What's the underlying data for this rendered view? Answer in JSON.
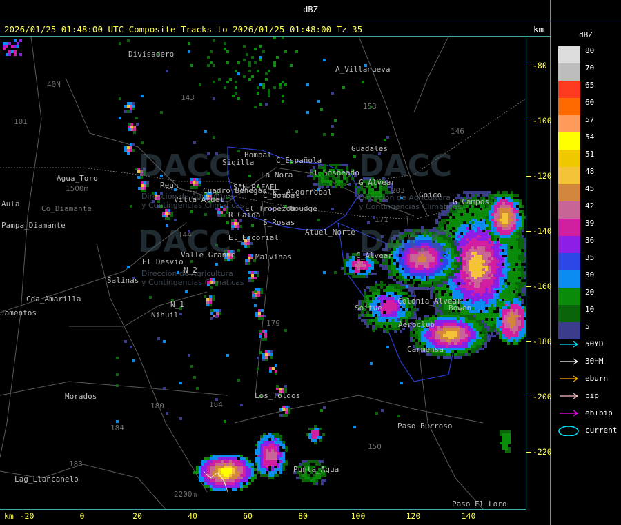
{
  "window": {
    "title": "dBZ"
  },
  "header": {
    "text": "2026/01/25 01:48:00 UTC Composite Tracks to 2026/01/25 01:48:00 Tz 35",
    "km_label": "km"
  },
  "axes": {
    "x_unit": "km",
    "x_ticks": [
      "-20",
      "0",
      "20",
      "40",
      "60",
      "80",
      "100",
      "120",
      "140"
    ],
    "y_ticks": [
      "-80",
      "-100",
      "-120",
      "-140",
      "-160",
      "-180",
      "-200",
      "-220"
    ]
  },
  "legend": {
    "title": "dBZ",
    "items": [
      {
        "label": "80",
        "color": "#dcdcdc"
      },
      {
        "label": "70",
        "color": "#bdbdbd"
      },
      {
        "label": "65",
        "color": "#ff3a1e"
      },
      {
        "label": "60",
        "color": "#ff6a00"
      },
      {
        "label": "57",
        "color": "#ff9a5a"
      },
      {
        "label": "54",
        "color": "#ffff00"
      },
      {
        "label": "51",
        "color": "#f0c800"
      },
      {
        "label": "48",
        "color": "#f5c337"
      },
      {
        "label": "45",
        "color": "#d2873c"
      },
      {
        "label": "42",
        "color": "#c86496"
      },
      {
        "label": "39",
        "color": "#d21ea0"
      },
      {
        "label": "36",
        "color": "#8c1ee6"
      },
      {
        "label": "35",
        "color": "#2d46e6"
      },
      {
        "label": "30",
        "color": "#0a8cf0"
      },
      {
        "label": "20",
        "color": "#0a8c0a"
      },
      {
        "label": "10",
        "color": "#0a640a"
      },
      {
        "label": "5",
        "color": "#3c3c8c"
      }
    ],
    "tracks": [
      {
        "label": "50YD",
        "color": "#00e6ff"
      },
      {
        "label": "30HM",
        "color": "#ffffff"
      },
      {
        "label": "eburn",
        "color": "#ffaa00"
      },
      {
        "label": "bip",
        "color": "#ffc0c0"
      },
      {
        "label": "eb+bip",
        "color": "#ff00ff"
      },
      {
        "label": "current",
        "color": "#00e6ff"
      }
    ]
  },
  "watermark": {
    "brand": "DACC",
    "lines": [
      "Dirección de Agricultura",
      "y Contingencias Climáticas"
    ]
  },
  "places": [
    {
      "name": "Divisadero"
    },
    {
      "name": "A_Villanueva"
    },
    {
      "name": "40N"
    },
    {
      "name": "101"
    },
    {
      "name": "143"
    },
    {
      "name": "153"
    },
    {
      "name": "146"
    },
    {
      "name": "Guadales"
    },
    {
      "name": "Agua_Toro"
    },
    {
      "name": "1500m"
    },
    {
      "name": "Aula"
    },
    {
      "name": "Co_Diamante"
    },
    {
      "name": "Pampa_Diamante"
    },
    {
      "name": "Reun"
    },
    {
      "name": "Villa_Atuel"
    },
    {
      "name": "Cuadro_Benegas"
    },
    {
      "name": "SAN_RAFAEL"
    },
    {
      "name": "Bombal"
    },
    {
      "name": "Sigilla"
    },
    {
      "name": "C_Española"
    },
    {
      "name": "La_Nora"
    },
    {
      "name": "El_Algarrobal"
    },
    {
      "name": "C_Bombal"
    },
    {
      "name": "El_Tropezon"
    },
    {
      "name": "Goudge"
    },
    {
      "name": "R_Caida"
    },
    {
      "name": "S_Rosas"
    },
    {
      "name": "Atuel_Norte"
    },
    {
      "name": "El_Escorial"
    },
    {
      "name": "Valle_Grande"
    },
    {
      "name": "Malvinas"
    },
    {
      "name": "El_Desvio"
    },
    {
      "name": "Salinas"
    },
    {
      "name": "Cda_Amarilla"
    },
    {
      "name": "N_2"
    },
    {
      "name": "N_1"
    },
    {
      "name": "Nihuil"
    },
    {
      "name": "Jamentos"
    },
    {
      "name": "El_Sosneado"
    },
    {
      "name": "G_Alvear"
    },
    {
      "name": "Goico"
    },
    {
      "name": "G_Campos"
    },
    {
      "name": "C_Alvear"
    },
    {
      "name": "Soitue"
    },
    {
      "name": "Bowen"
    },
    {
      "name": "Carmensa"
    },
    {
      "name": "Aeroclub"
    },
    {
      "name": "Colonia_Alvear"
    },
    {
      "name": "Morados"
    },
    {
      "name": "180"
    },
    {
      "name": "184"
    },
    {
      "name": "Los_Toldos"
    },
    {
      "name": "Paso_Burroso"
    },
    {
      "name": "Lag_Llancanelo"
    },
    {
      "name": "Punta_Agua"
    },
    {
      "name": "2200m"
    },
    {
      "name": "Paso_El_Loro"
    },
    {
      "name": "150"
    },
    {
      "name": "179"
    },
    {
      "name": "203"
    },
    {
      "name": "171"
    },
    {
      "name": "144"
    },
    {
      "name": "183"
    },
    {
      "name": "143b"
    }
  ]
}
